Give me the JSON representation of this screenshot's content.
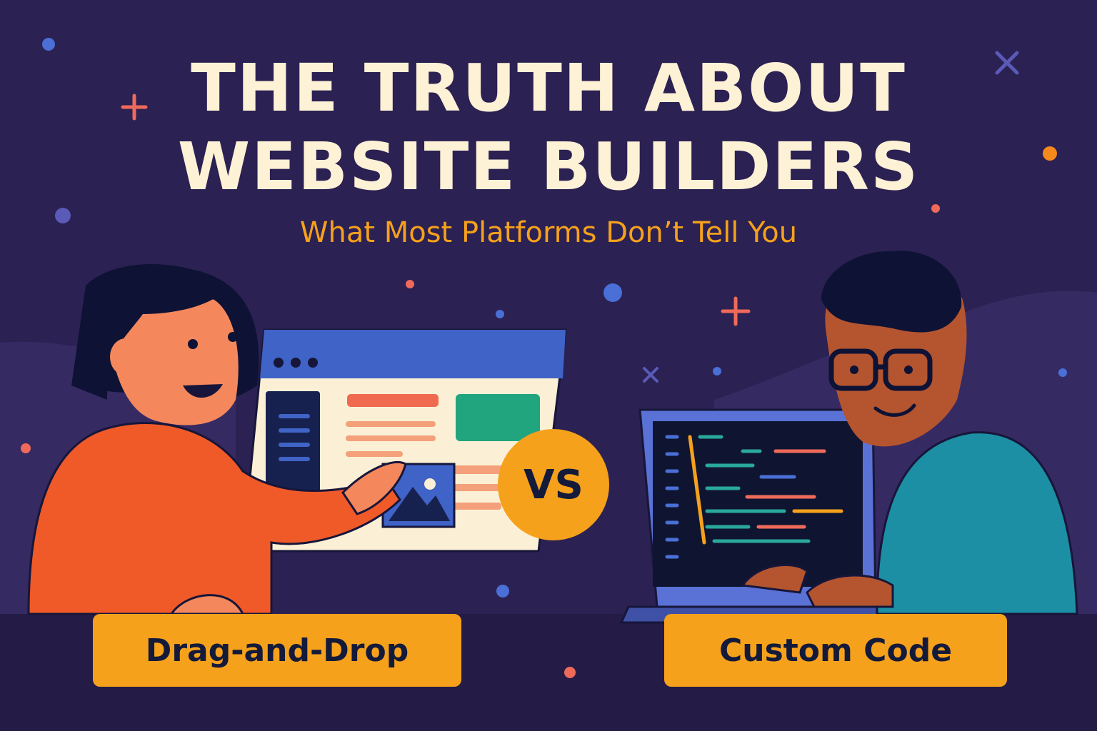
{
  "title": {
    "line1": "THE TRUTH ABOUT",
    "line2": "WEBSITE BUILDERS"
  },
  "subtitle": "What Most Platforms Don’t Tell You",
  "comparison": {
    "left_label": "Drag-and-Drop",
    "right_label": "Custom Code",
    "vs_label": "VS"
  },
  "colors": {
    "background": "#2b2152",
    "title": "#fdf1d6",
    "accent": "#f6a11c",
    "label_text": "#141a3a"
  }
}
